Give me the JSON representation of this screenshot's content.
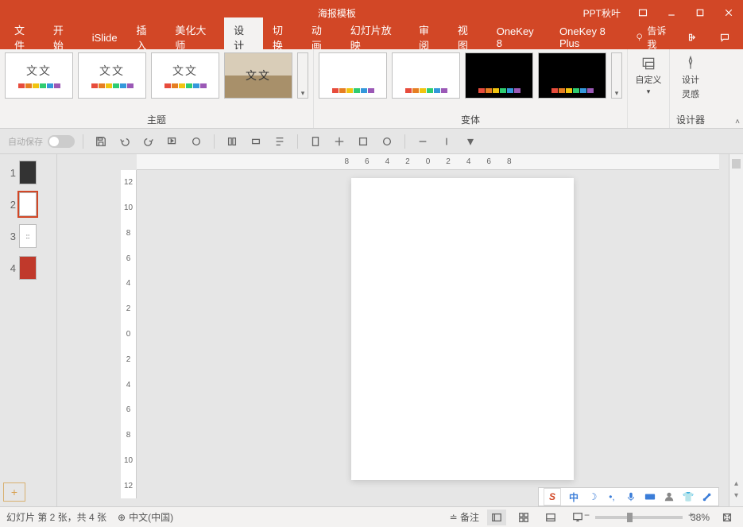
{
  "titlebar": {
    "title": "海报模板",
    "account": "PPT秋叶"
  },
  "menu": {
    "tabs": [
      "文件",
      "开始",
      "iSlide",
      "插入",
      "美化大师",
      "设计",
      "切换",
      "动画",
      "幻灯片放映",
      "审阅",
      "视图",
      "OneKey 8",
      "OneKey 8 Plus"
    ],
    "active_index": 5,
    "tellme": "告诉我"
  },
  "ribbon": {
    "themes_label": "主题",
    "variants_label": "变体",
    "custom_label": "自定义",
    "design_ideas_line1": "设计",
    "design_ideas_line2": "灵感",
    "designer_label": "设计器",
    "aa_text": "文文"
  },
  "qat": {
    "autosave_label": "自动保存"
  },
  "slides": {
    "items": [
      {
        "num": "1"
      },
      {
        "num": "2"
      },
      {
        "num": "3"
      },
      {
        "num": "4"
      }
    ],
    "active_index": 1
  },
  "ruler": {
    "h": [
      "8",
      "6",
      "4",
      "2",
      "0",
      "2",
      "4",
      "6",
      "8"
    ],
    "v": [
      "12",
      "10",
      "8",
      "6",
      "4",
      "2",
      "0",
      "2",
      "4",
      "6",
      "8",
      "10",
      "12"
    ]
  },
  "ime": {
    "lang": "中"
  },
  "status": {
    "slide_info": "幻灯片 第 2 张，共 4 张",
    "lang": "中文(中国)",
    "notes": "备注",
    "zoom": "38%"
  }
}
